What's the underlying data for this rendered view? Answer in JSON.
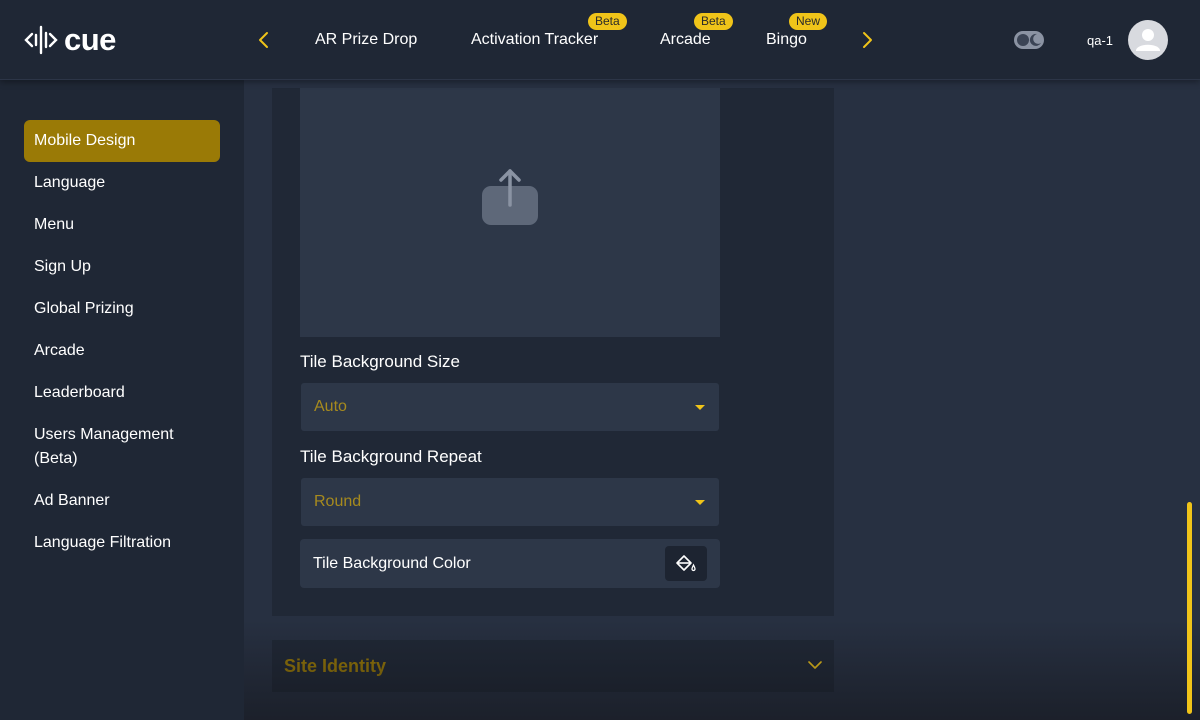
{
  "header": {
    "logo_text": "cue",
    "tabs": [
      {
        "label": "AR Prize Drop",
        "badge": ""
      },
      {
        "label": "Activation Tracker",
        "badge": "Beta"
      },
      {
        "label": "Arcade",
        "badge": "Beta"
      },
      {
        "label": "Bingo",
        "badge": "New"
      }
    ],
    "username": "qa-1",
    "accent_color": "#f0c419"
  },
  "sidebar": {
    "items": [
      {
        "label": "Mobile Design",
        "active": true
      },
      {
        "label": "Language"
      },
      {
        "label": "Menu"
      },
      {
        "label": "Sign Up"
      },
      {
        "label": "Global Prizing"
      },
      {
        "label": "Arcade"
      },
      {
        "label": "Leaderboard"
      },
      {
        "label": "Users Management (Beta)"
      },
      {
        "label": "Ad Banner"
      },
      {
        "label": "Language Filtration"
      }
    ],
    "active_color": "#9a7a06"
  },
  "main": {
    "tile_background_size": {
      "label": "Tile Background Size",
      "value": "Auto"
    },
    "tile_background_repeat": {
      "label": "Tile Background Repeat",
      "value": "Round"
    },
    "tile_background_color": {
      "label": "Tile Background Color"
    },
    "site_identity": {
      "title": "Site Identity"
    }
  }
}
